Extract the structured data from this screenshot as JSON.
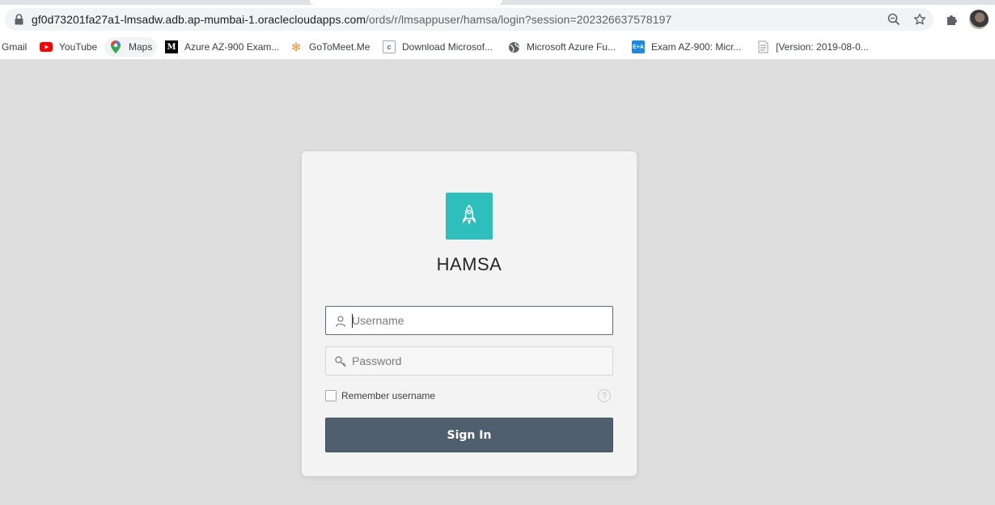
{
  "browser": {
    "url_host": "gf0d73201fa27a1-lmsadw.adb.ap-mumbai-1.oraclecloudapps.com",
    "url_path": "/ords/r/lmsappuser/hamsa/login?session=202326637578197"
  },
  "bookmarks": [
    {
      "label": "Gmail",
      "icon": "gmail-icon"
    },
    {
      "label": "YouTube",
      "icon": "youtube-icon"
    },
    {
      "label": "Maps",
      "icon": "maps-icon"
    },
    {
      "label": "Azure AZ-900 Exam...",
      "icon": "medium-icon"
    },
    {
      "label": "GoToMeet.Me",
      "icon": "gotomeet-icon"
    },
    {
      "label": "Download Microsof...",
      "icon": "page-icon"
    },
    {
      "label": "Microsoft Azure Fu...",
      "icon": "globe-icon"
    },
    {
      "label": "Exam AZ-900: Micr...",
      "icon": "exam-icon"
    },
    {
      "label": "[Version: 2019-08-0...",
      "icon": "document-icon"
    }
  ],
  "login": {
    "app_title": "HAMSA",
    "username_placeholder": "Username",
    "password_placeholder": "Password",
    "remember_label": "Remember username",
    "help_symbol": "?",
    "signin_label": "Sign In",
    "accent_color": "#2ebfbc",
    "button_color": "#505f6d"
  }
}
